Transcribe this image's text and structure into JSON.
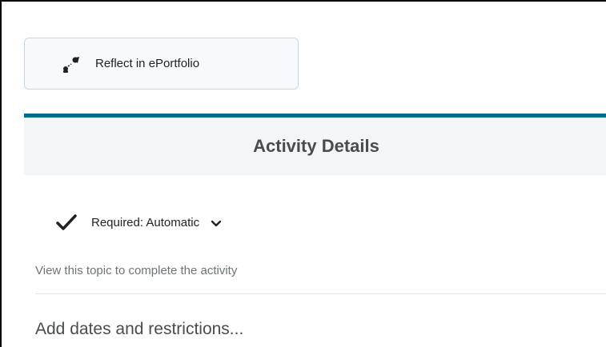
{
  "reflect": {
    "label": "Reflect in ePortfolio",
    "icon": "eportfolio-reflect-icon"
  },
  "details": {
    "title": "Activity Details",
    "accent_color": "#006e88",
    "requirement_label": "Required: Automatic",
    "requirement_description": "View this topic to complete the activity",
    "add_dates_label": "Add dates and restrictions..."
  }
}
